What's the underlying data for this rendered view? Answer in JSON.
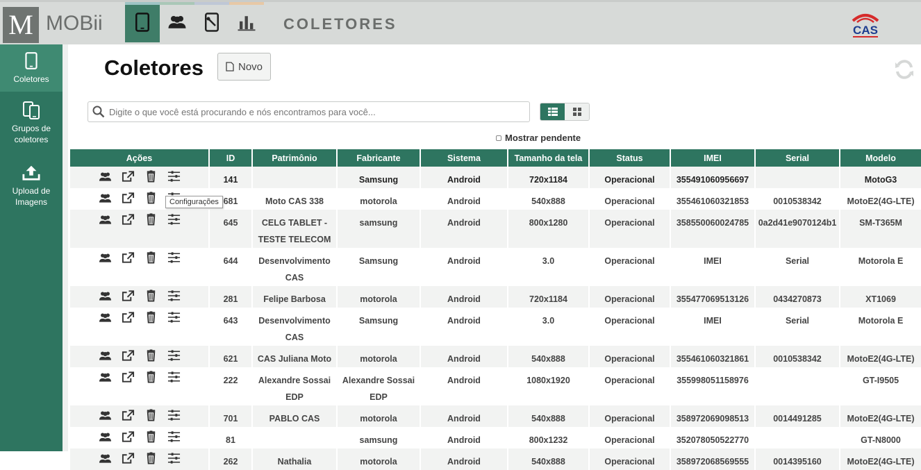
{
  "app": {
    "logo_letter": "M",
    "logo_name": "MOBii",
    "page_label": "COLETORES",
    "brand_sub": "CAS"
  },
  "topnav": [
    {
      "icon": "tablet-icon",
      "accent": "#9ec4c4",
      "active": true
    },
    {
      "icon": "users-icon",
      "accent": "#a9c7b7",
      "active": false
    },
    {
      "icon": "wrench-tablet-icon",
      "accent": "#bfc7d6",
      "active": false
    },
    {
      "icon": "bar-chart-icon",
      "accent": "#e7c8a6",
      "active": false
    }
  ],
  "sidebar": [
    {
      "label": "Coletores",
      "icon": "tablet-icon",
      "active": true
    },
    {
      "label": "Grupos de coletores",
      "icon": "tablets-icon",
      "active": false
    },
    {
      "label": "Upload de Imagens",
      "icon": "upload-icon",
      "active": false
    }
  ],
  "main": {
    "title": "Coletores",
    "new_button": "Novo",
    "search_placeholder": "Digite o que você está procurando e nós encontramos para você...",
    "show_pending": "Mostrar pendente",
    "tooltip": "Configurações"
  },
  "table": {
    "headers": [
      "Ações",
      "ID",
      "Patrimônio",
      "Fabricante",
      "Sistema",
      "Tamanho da tela",
      "Status",
      "IMEI",
      "Serial",
      "Modelo"
    ],
    "rows": [
      {
        "id": "141",
        "patrimonio": "",
        "fabricante": "Samsung",
        "sistema": "Android",
        "tela": "720x1184",
        "status": "Operacional",
        "imei": "355491060956697",
        "serial": "",
        "modelo": "MotoG3"
      },
      {
        "id": "681",
        "patrimonio": "Moto CAS 338",
        "fabricante": "motorola",
        "sistema": "Android",
        "tela": "540x888",
        "status": "Operacional",
        "imei": "355461060321853",
        "serial": "0010538342",
        "modelo": "MotoE2(4G-LTE)"
      },
      {
        "id": "645",
        "patrimonio": "CELG TABLET - TESTE TELECOM",
        "fabricante": "samsung",
        "sistema": "Android",
        "tela": "800x1280",
        "status": "Operacional",
        "imei": "358550060024785",
        "serial": "0a2d41e9070124b1",
        "modelo": "SM-T365M"
      },
      {
        "id": "644",
        "patrimonio": "Desenvolvimento CAS",
        "fabricante": "Samsung",
        "sistema": "Android",
        "tela": "3.0",
        "status": "Operacional",
        "imei": "IMEI",
        "serial": "Serial",
        "modelo": "Motorola E"
      },
      {
        "id": "281",
        "patrimonio": "Felipe Barbosa",
        "fabricante": "motorola",
        "sistema": "Android",
        "tela": "720x1184",
        "status": "Operacional",
        "imei": "355477069513126",
        "serial": "0434270873",
        "modelo": "XT1069"
      },
      {
        "id": "643",
        "patrimonio": "Desenvolvimento CAS",
        "fabricante": "Samsung",
        "sistema": "Android",
        "tela": "3.0",
        "status": "Operacional",
        "imei": "IMEI",
        "serial": "Serial",
        "modelo": "Motorola E"
      },
      {
        "id": "621",
        "patrimonio": "CAS Juliana Moto",
        "fabricante": "motorola",
        "sistema": "Android",
        "tela": "540x888",
        "status": "Operacional",
        "imei": "355461060321861",
        "serial": "0010538342",
        "modelo": "MotoE2(4G-LTE)"
      },
      {
        "id": "222",
        "patrimonio": "Alexandre Sossai EDP",
        "fabricante": "Alexandre Sossai EDP",
        "sistema": "Android",
        "tela": "1080x1920",
        "status": "Operacional",
        "imei": "355998051158976",
        "serial": "",
        "modelo": "GT-I9505"
      },
      {
        "id": "701",
        "patrimonio": "PABLO CAS",
        "fabricante": "motorola",
        "sistema": "Android",
        "tela": "540x888",
        "status": "Operacional",
        "imei": "358972069098513",
        "serial": "0014491285",
        "modelo": "MotoE2(4G-LTE)"
      },
      {
        "id": "81",
        "patrimonio": "",
        "fabricante": "samsung",
        "sistema": "Android",
        "tela": "800x1232",
        "status": "Operacional",
        "imei": "352078050522770",
        "serial": "",
        "modelo": "GT-N8000"
      },
      {
        "id": "262",
        "patrimonio": "Nathalia",
        "fabricante": "motorola",
        "sistema": "Android",
        "tela": "540x888",
        "status": "Operacional",
        "imei": "358972068569555",
        "serial": "0014395160",
        "modelo": "MotoE2(4G-LTE)"
      }
    ]
  },
  "colors": {
    "primary": "#2e7560",
    "sidebar_active": "#3f8a72",
    "topbar": "#d7dad8"
  }
}
